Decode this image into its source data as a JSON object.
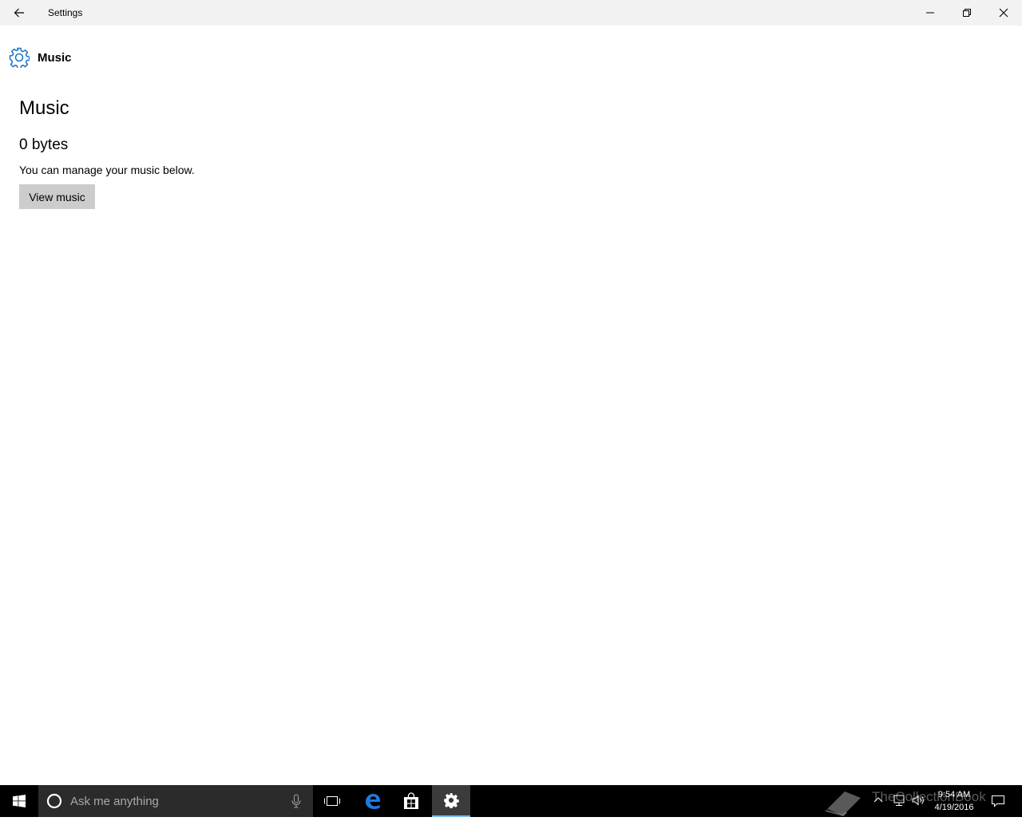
{
  "window": {
    "title": "Settings",
    "controls": [
      "minimize",
      "restore",
      "close"
    ]
  },
  "header": {
    "icon": "gear-icon",
    "title": "Music"
  },
  "main": {
    "page_title": "Music",
    "size": "0 bytes",
    "description": "You can manage your music below.",
    "view_button_label": "View music"
  },
  "taskbar": {
    "search_placeholder": "Ask me anything",
    "apps": [
      "task-view-icon",
      "edge-icon",
      "store-icon",
      "settings-icon"
    ],
    "active_app": "settings-icon",
    "clock": {
      "time": "9:54 AM",
      "date": "4/19/2016"
    },
    "watermark": "TheCollectionBook"
  },
  "colors": {
    "accent": "#1a73c8",
    "titlebar_bg": "#f2f2f2",
    "button_bg": "#cccccc",
    "taskbar_bg": "#000000",
    "search_bg": "#2b2b2b"
  }
}
